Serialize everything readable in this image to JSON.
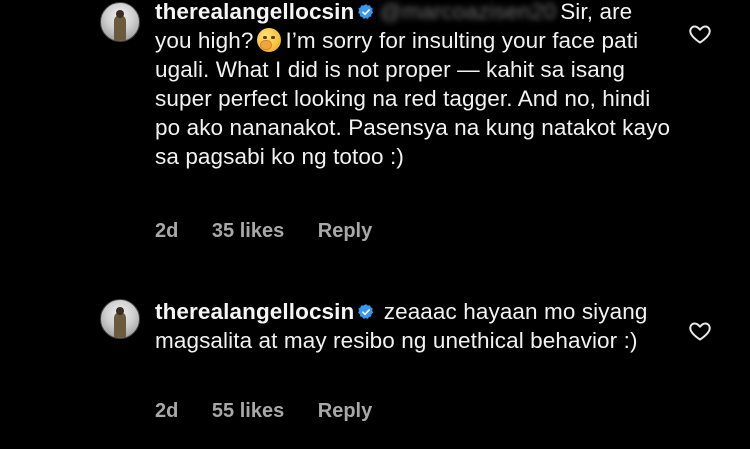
{
  "comments": [
    {
      "username": "therealangellocsin",
      "mention": "@marcoazisen20",
      "text_a": "Sir, are you high?",
      "text_b": "I’m sorry for insulting your face pati ugali. What I did is not proper — kahit sa isang super perfect looking na red tagger. And no, hindi po ako nananakot. Pasensya na kung natakot kayo sa pagsabi ko ng totoo :)",
      "age": "2d",
      "likes": "35 likes",
      "reply_label": "Reply"
    },
    {
      "username": "therealangellocsin",
      "text": "zeaaac hayaan mo siyang magsalita at may resibo ng unethical behavior :)",
      "age": "2d",
      "likes": "55 likes",
      "reply_label": "Reply"
    }
  ],
  "colors": {
    "background": "#000000",
    "text": "#f2f2f2",
    "meta": "#a8a8a8",
    "verified": "#3897f0"
  },
  "icons": {
    "verified": "verified-badge-icon",
    "like": "heart-outline-icon",
    "emoji": "face-with-hand-over-mouth-emoji"
  }
}
